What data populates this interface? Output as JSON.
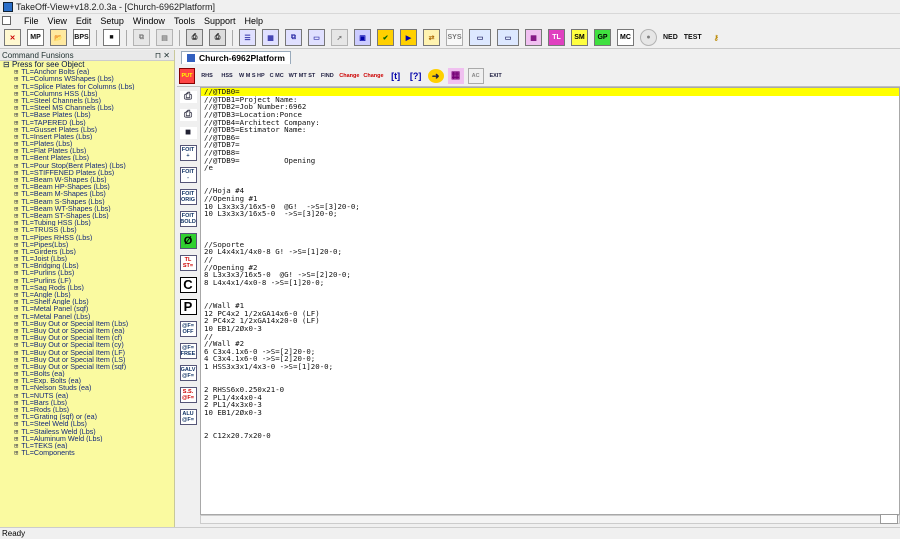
{
  "window": {
    "title": "TakeOff-View+v18.2.0.3a - [Church-6962Platform]"
  },
  "menu": [
    "File",
    "View",
    "Edit",
    "Setup",
    "Window",
    "Tools",
    "Support",
    "Help"
  ],
  "toolbar_icons": [
    "close-x-icon",
    "mp-icon",
    "open-icon",
    "bps-icon",
    "save-icon",
    "copy-icon",
    "paste-icon",
    "print-icon",
    "print-preview-icon",
    "list-icon",
    "grid-icon",
    "copy-doc-icon",
    "doc-icon",
    "pointer-icon",
    "report-icon",
    "check-icon",
    "play-icon",
    "exchange-icon",
    "sys-icon",
    "window-icon",
    "window2-icon",
    "pink-grid-icon",
    "tl-icon",
    "sm-icon",
    "gp-icon",
    "mc-icon",
    "dimmed-icon",
    "ned-icon",
    "test-icon",
    "key-icon"
  ],
  "toolbar_labels": {
    "mp": "MP",
    "bps": "BPS",
    "sys": "SYS",
    "tl": "TL",
    "sm": "SM",
    "gp": "GP",
    "mc": "MC",
    "ned": "NED",
    "test": "TEST"
  },
  "sidebar": {
    "title": "Command Funsions",
    "root": "Press for see Object",
    "items": [
      "TL=Anchor Bolts (ea)",
      "TL=Columns WShapes (Lbs)",
      "TL=Splice Plates for Columns (Lbs)",
      "TL=Columns HSS (Lbs)",
      "TL=Steel Channels (Lbs)",
      "TL=Steel MS Channels (Lbs)",
      "TL=Base Plates (Lbs)",
      "TL=TAPERED (Lbs)",
      "TL=Gusset Plates (Lbs)",
      "TL=Insert Plates (Lbs)",
      "TL=Plates (Lbs)",
      "TL=Flat Plates (Lbs)",
      "TL=Bent Plates (Lbs)",
      "TL=Pour Stop(Bent Plates) (Lbs)",
      "TL=STIFFENED Plates (Lbs)",
      "TL=Beam W-Shapes (Lbs)",
      "TL=Beam HP-Shapes (Lbs)",
      "TL=Beam M-Shapes (Lbs)",
      "TL=Beam S-Shapes (Lbs)",
      "TL=Beam WT-Shapes (Lbs)",
      "TL=Beam ST-Shapes (Lbs)",
      "TL=Tubing HSS (Lbs)",
      "TL=TRUSS (Lbs)",
      "TL=Pipes RHSS (Lbs)",
      "TL=Pipes(Lbs)",
      "TL=Girders (Lbs)",
      "TL=Joist (Lbs)",
      "TL=Bridging (Lbs)",
      "TL=Purlins (Lbs)",
      "TL=Purlins (LF)",
      "TL=Sag Rods (Lbs)",
      "TL=Angle (Lbs)",
      "TL=Shelf Angle (Lbs)",
      "TL=Metal Panel (sqf)",
      "TL=Metal Panel (Lbs)",
      "TL=Buy Out or Special Item (Lbs)",
      "TL=Buy Out or Special Item (ea)",
      "TL=Buy Out or Special Item (cf)",
      "TL=Buy Out or Special Item (cy)",
      "TL=Buy Out or Special Item (LF)",
      "TL=Buy Out or Special Item (LS)",
      "TL=Buy Out or Special Item (sqf)",
      "TL=Bolts (ea)",
      "TL=Exp. Bolts (ea)",
      "TL=Nelson Studs (ea)",
      "TL=NUTS (ea)",
      "TL=Bars (Lbs)",
      "TL=Rods (Lbs)",
      "TL=Grating (sqf) or (ea)",
      "TL=Steel Weld (Lbs)",
      "TL=Stailess Weld (Lbs)",
      "TL=Aluminum Weld (Lbs)",
      "TL=TEKS (ea)",
      "TL=Components"
    ]
  },
  "doc_tab": "Church-6962Platform",
  "editor_toolbar": [
    "PUT",
    "RHS",
    "HSS",
    "W M S HP",
    "C MC",
    "WT MT ST",
    "FIND",
    "Change",
    "Change",
    "[t]",
    "[?]",
    "circle-arrow",
    "pink-grid",
    "AC",
    "EXIT"
  ],
  "side_buttons": [
    "print",
    "print2",
    "save",
    "FOIT +",
    "FOIT -",
    "FOIT ORIG",
    "FOIT BOLD",
    "Ø",
    "TL ST=",
    "C",
    "P",
    "@F= OFF",
    "@F= FREE",
    "GALV @F=",
    "S.S. @F=",
    "ALU @F="
  ],
  "editor_lines": [
    "//@TDB0=",
    "//@TDB1=Project Name:",
    "//@TDB2=Job Number:6962",
    "//@TDB3=Location:Ponce",
    "//@TDB4=Architect Company:",
    "//@TDB5=Estimator Name:",
    "//@TDB6=",
    "//@TDB7=",
    "//@TDB8=",
    "//@TDB9=          Opening",
    "/e",
    "",
    "",
    "//Hoja #4",
    "//Opening #1",
    "10 L3x3x3/16x5-0  @G!  ->S=[3]20-0;",
    "10 L3x3x3/16x5-0  ->S=[3]20-0;",
    "",
    "",
    "",
    "//Soporte",
    "20 L4x4x1/4x0-8 G! ->S=[1]20-0;",
    "//",
    "//Opening #2",
    "8 L3x3x3/16x5-0  @G! ->S=[2]20-0;",
    "8 L4x4x1/4x0-8 ->S=[1]20-0;",
    "",
    "",
    "//Wall #1",
    "12 PC4x2 1/2xGA14x6-0 (LF)",
    "2 PC4x2 1/2xGA14x20-0 (LF)",
    "10 EB1/2Øx0-3",
    "//",
    "//Wall #2",
    "6 C3x4.1x6-0 ->S=[2]20-0;",
    "4 C3x4.1x6-0 ->S=[2]20-0;",
    "1 HSS3x3x1/4x3-0 ->S=[1]20-0;",
    "",
    "",
    "2 RHSS6x0.250x21-0",
    "2 PL1/4x4x0-4",
    "2 PL1/4x3x0-3",
    "10 EB1/2Øx0-3",
    "",
    "",
    "2 C12x20.7x20-0"
  ],
  "status": "Ready"
}
